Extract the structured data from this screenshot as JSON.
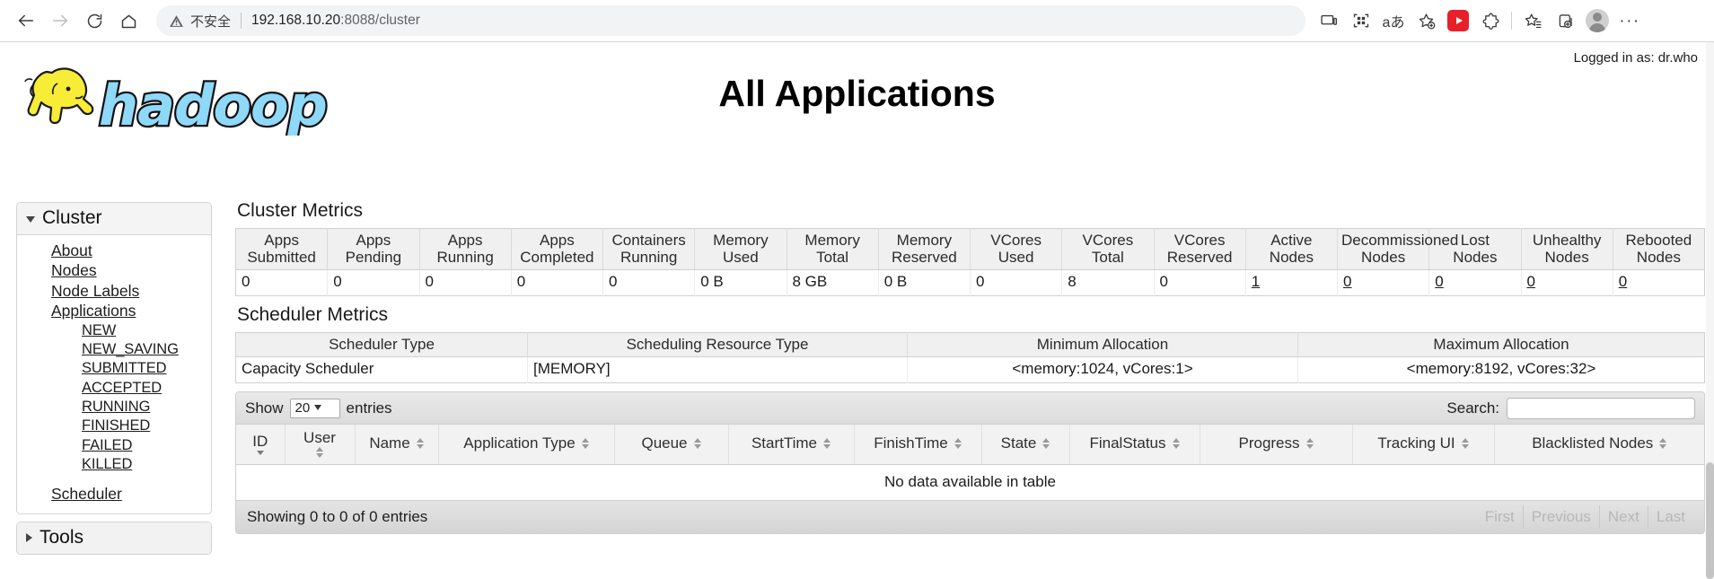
{
  "browser": {
    "back_icon": "back-arrow-icon",
    "forward_icon": "forward-arrow-icon",
    "reload_icon": "reload-icon",
    "home_icon": "home-icon",
    "security_label": "不安全",
    "url_host": "192.168.10.20",
    "url_rest": ":8088/cluster",
    "url_full": "192.168.10.20:8088/cluster",
    "toolbar_icons": [
      "cast-device-icon",
      "qr-code-icon",
      "translate-icon",
      "add-favorite-icon",
      "video-extension-icon",
      "extensions-puzzle-icon",
      "favorites-list-icon",
      "collections-icon",
      "profile-avatar-icon",
      "settings-more-icon"
    ],
    "translate_label": "aあ",
    "more_label": "···"
  },
  "header": {
    "title": "All Applications",
    "logged_in": "Logged in as: dr.who",
    "logo_text": "hadoop"
  },
  "sidebar": {
    "cluster": {
      "label": "Cluster",
      "expanded": true,
      "links": [
        {
          "label": "About"
        },
        {
          "label": "Nodes"
        },
        {
          "label": "Node Labels"
        },
        {
          "label": "Applications"
        }
      ],
      "app_states": [
        {
          "label": "NEW"
        },
        {
          "label": "NEW_SAVING"
        },
        {
          "label": "SUBMITTED"
        },
        {
          "label": "ACCEPTED"
        },
        {
          "label": "RUNNING"
        },
        {
          "label": "FINISHED"
        },
        {
          "label": "FAILED"
        },
        {
          "label": "KILLED"
        }
      ],
      "scheduler_link": {
        "label": "Scheduler"
      }
    },
    "tools": {
      "label": "Tools",
      "expanded": false
    }
  },
  "cluster_metrics": {
    "title": "Cluster Metrics",
    "columns": [
      {
        "line1": "Apps",
        "line2": "Submitted"
      },
      {
        "line1": "Apps",
        "line2": "Pending"
      },
      {
        "line1": "Apps",
        "line2": "Running"
      },
      {
        "line1": "Apps",
        "line2": "Completed"
      },
      {
        "line1": "Containers",
        "line2": "Running"
      },
      {
        "line1": "Memory",
        "line2": "Used"
      },
      {
        "line1": "Memory",
        "line2": "Total"
      },
      {
        "line1": "Memory",
        "line2": "Reserved"
      },
      {
        "line1": "VCores",
        "line2": "Used"
      },
      {
        "line1": "VCores",
        "line2": "Total"
      },
      {
        "line1": "VCores",
        "line2": "Reserved"
      },
      {
        "line1": "Active",
        "line2": "Nodes"
      },
      {
        "line1": "Decommissioned",
        "line2": "Nodes"
      },
      {
        "line1": "Lost",
        "line2": "Nodes"
      },
      {
        "line1": "Unhealthy",
        "line2": "Nodes"
      },
      {
        "line1": "Rebooted",
        "line2": "Nodes"
      }
    ],
    "values": [
      {
        "text": "0",
        "link": false
      },
      {
        "text": "0",
        "link": false
      },
      {
        "text": "0",
        "link": false
      },
      {
        "text": "0",
        "link": false
      },
      {
        "text": "0",
        "link": false
      },
      {
        "text": "0 B",
        "link": false
      },
      {
        "text": "8 GB",
        "link": false
      },
      {
        "text": "0 B",
        "link": false
      },
      {
        "text": "0",
        "link": false
      },
      {
        "text": "8",
        "link": false
      },
      {
        "text": "0",
        "link": false
      },
      {
        "text": "1",
        "link": true
      },
      {
        "text": "0",
        "link": true
      },
      {
        "text": "0",
        "link": true
      },
      {
        "text": "0",
        "link": true
      },
      {
        "text": "0",
        "link": true
      }
    ]
  },
  "scheduler_metrics": {
    "title": "Scheduler Metrics",
    "columns": [
      "Scheduler Type",
      "Scheduling Resource Type",
      "Minimum Allocation",
      "Maximum Allocation"
    ],
    "row": [
      "Capacity Scheduler",
      "[MEMORY]",
      "<memory:1024, vCores:1>",
      "<memory:8192, vCores:32>"
    ]
  },
  "apps_table": {
    "show_label": "Show",
    "entries_label": "entries",
    "page_size": "20",
    "search_label": "Search:",
    "search_value": "",
    "search_placeholder": "",
    "columns": [
      {
        "label": "ID",
        "sort": "desc"
      },
      {
        "label": "User",
        "sort": "none"
      },
      {
        "label": "Name",
        "sort": "none"
      },
      {
        "label": "Application Type",
        "sort": "none"
      },
      {
        "label": "Queue",
        "sort": "none"
      },
      {
        "label": "StartTime",
        "sort": "none"
      },
      {
        "label": "FinishTime",
        "sort": "none"
      },
      {
        "label": "State",
        "sort": "none"
      },
      {
        "label": "FinalStatus",
        "sort": "none"
      },
      {
        "label": "Progress",
        "sort": "none"
      },
      {
        "label": "Tracking UI",
        "sort": "none"
      },
      {
        "label": "Blacklisted Nodes",
        "sort": "none"
      }
    ],
    "rows": [],
    "empty_text": "No data available in table",
    "info_text": "Showing 0 to 0 of 0 entries",
    "paging": [
      {
        "label": "First",
        "disabled": true
      },
      {
        "label": "Previous",
        "disabled": true
      },
      {
        "label": "Next",
        "disabled": true
      },
      {
        "label": "Last",
        "disabled": true
      }
    ]
  }
}
